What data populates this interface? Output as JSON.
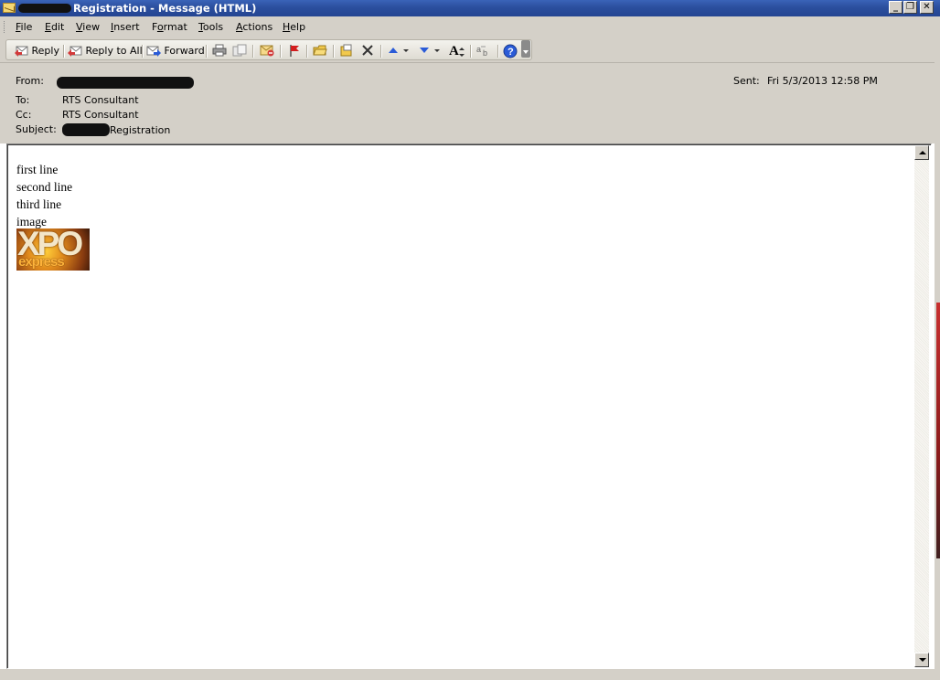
{
  "window": {
    "title": "Registration - Message (HTML)",
    "controls": {
      "minimize": "_",
      "restore": "❐",
      "close": "✕"
    }
  },
  "menu": {
    "items": [
      "File",
      "Edit",
      "View",
      "Insert",
      "Format",
      "Tools",
      "Actions",
      "Help"
    ]
  },
  "toolbar": {
    "reply": "Reply",
    "reply_all": "Reply to All",
    "forward": "Forward",
    "font_size_glyph": "A"
  },
  "header": {
    "from_label": "From:",
    "to_label": "To:",
    "to_value": "RTS Consultant",
    "cc_label": "Cc:",
    "cc_value": "RTS Consultant",
    "subject_label": "Subject:",
    "subject_value": "Registration",
    "sent_label": "Sent:",
    "sent_value": "Fri 5/3/2013 12:58 PM"
  },
  "body": {
    "lines": [
      "first line",
      "second line",
      "third line",
      "image"
    ],
    "image": {
      "big_text": "XPO",
      "small_text": "express"
    }
  },
  "colors": {
    "titlebar": "#2b4f9e",
    "chrome": "#d4d0c8",
    "link_blue": "#2a5bd7"
  }
}
